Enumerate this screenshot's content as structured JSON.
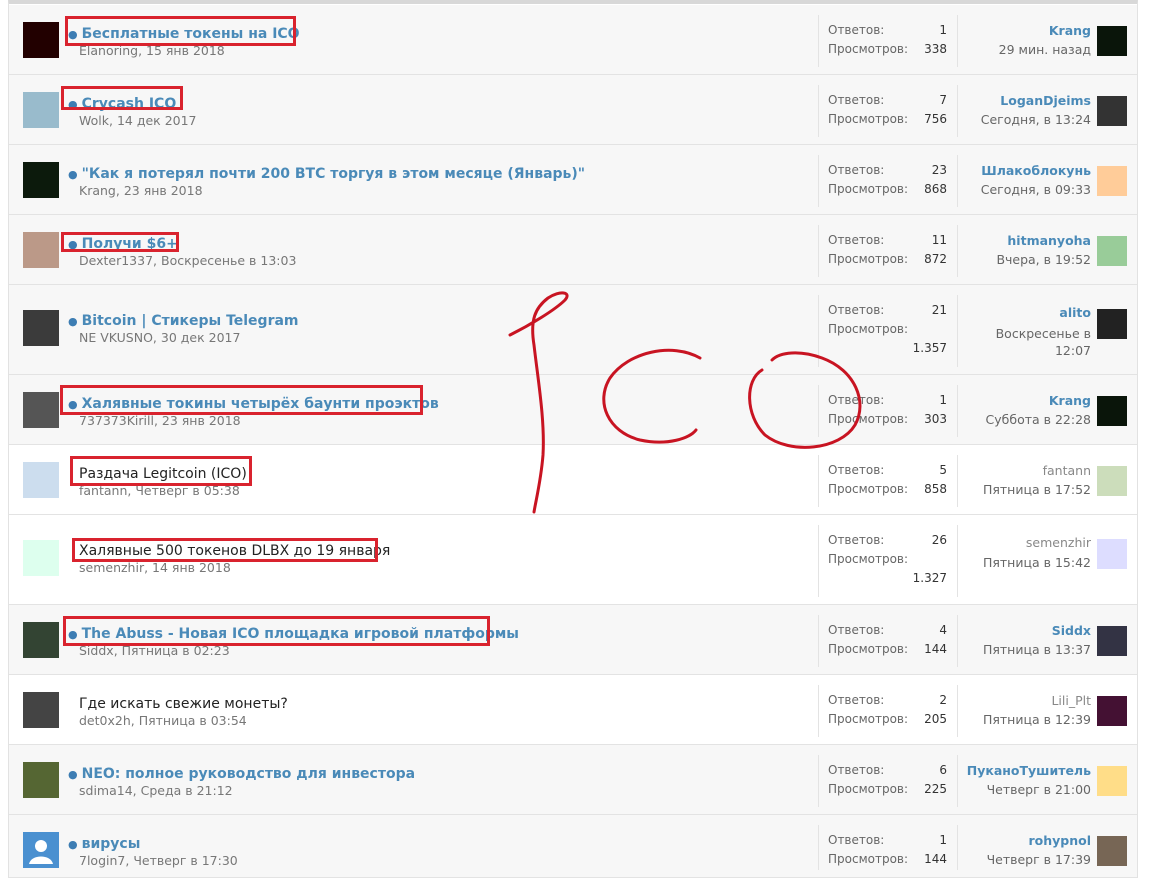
{
  "stats_labels": {
    "replies": "Ответов:",
    "views": "Просмотров:"
  },
  "threads": [
    {
      "title": "Бесплатные токены на ICO",
      "author": "Elanoring",
      "date": "15 янв 2018",
      "replies": "1",
      "views": "338",
      "last_user": "Krang",
      "last_time": "29 мин. назад"
    },
    {
      "title": "Crycash ICO",
      "author": "Wolk",
      "date": "14 дек 2017",
      "replies": "7",
      "views": "756",
      "last_user": "LoganDjeims",
      "last_time": "Сегодня, в 13:24"
    },
    {
      "title": "\"Как я потерял почти 200 BTC торгуя в этом месяце (Январь)\"",
      "author": "Krang",
      "date": "23 янв 2018",
      "replies": "23",
      "views": "868",
      "last_user": "Шлакоблокунь",
      "last_time": "Сегодня, в 09:33"
    },
    {
      "title": "Получи $6+",
      "author": "Dexter1337",
      "date": "Воскресенье в 13:03",
      "replies": "11",
      "views": "872",
      "last_user": "hitmanyoha",
      "last_time": "Вчера, в 19:52"
    },
    {
      "title": "Bitcoin | Стикеры Telegram",
      "author": "NE VKUSNO",
      "date": "30 дек 2017",
      "replies": "21",
      "views": "1.357",
      "last_user": "alito",
      "last_time": "Воскресенье в 12:07"
    },
    {
      "title": "Халявные токины четырёх баунти проэктов",
      "author": "737373Kirill",
      "date": "23 янв 2018",
      "replies": "1",
      "views": "303",
      "last_user": "Krang",
      "last_time": "Суббота в 22:28"
    },
    {
      "title": "Раздача Legitcoin (ICO)",
      "author": "fantann",
      "date": "Четверг в 05:38",
      "replies": "5",
      "views": "858",
      "last_user": "fantann",
      "last_time": "Пятница в 17:52"
    },
    {
      "title": "Халявные 500 токенов DLBX до 19 января",
      "author": "semenzhir",
      "date": "14 янв 2018",
      "replies": "26",
      "views": "1.327",
      "last_user": "semenzhir",
      "last_time": "Пятница в 15:42"
    },
    {
      "title": "The Abuss - Новая ICO площадка игровой платформы",
      "author": "Siddx",
      "date": "Пятница в 02:23",
      "replies": "4",
      "views": "144",
      "last_user": "Siddx",
      "last_time": "Пятница в 13:37"
    },
    {
      "title": "Где искать свежие монеты?",
      "author": "det0x2h",
      "date": "Пятница в 03:54",
      "replies": "2",
      "views": "205",
      "last_user": "Lili_Plt",
      "last_time": "Пятница в 12:39"
    },
    {
      "title": "NEO: полное руководство для инвестора",
      "author": "sdima14",
      "date": "Среда в 21:12",
      "replies": "6",
      "views": "225",
      "last_user": "ПуканоТушитель",
      "last_time": "Четверг в 21:00"
    },
    {
      "title": "вирусы",
      "author": "7login7",
      "date": "Четверг в 17:30",
      "replies": "1",
      "views": "144",
      "last_user": "rohypnol",
      "last_time": "Четверг в 17:39"
    }
  ],
  "colors": {
    "link": "#4a8ab8",
    "highlight": "#d9232e",
    "unread_bg": "#f7f7f7"
  }
}
